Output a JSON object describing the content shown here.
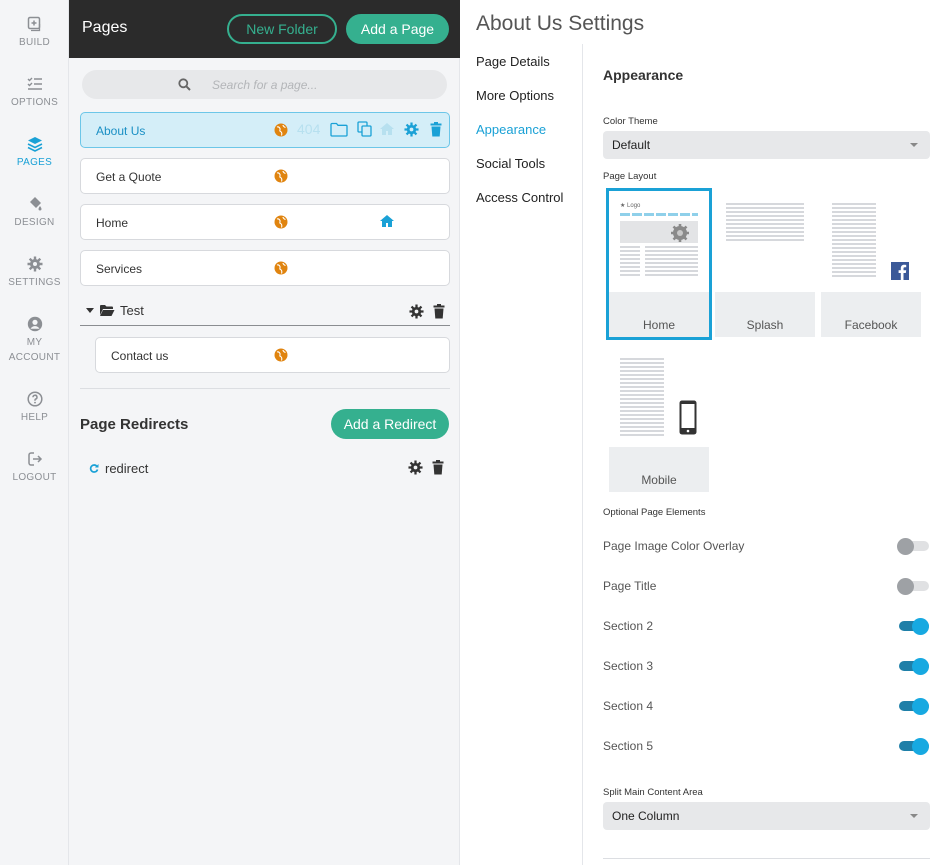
{
  "colors": {
    "accent": "#1aa1d6",
    "green": "#35b08f",
    "header_dark": "#2b2b2b",
    "globe_orange": "#e0840f"
  },
  "rail": {
    "items": [
      {
        "label": "BUILD",
        "icon": "plus-square-icon"
      },
      {
        "label": "OPTIONS",
        "icon": "checklist-icon"
      },
      {
        "label": "PAGES",
        "icon": "layers-icon",
        "active": true
      },
      {
        "label": "DESIGN",
        "icon": "paint-bucket-icon"
      },
      {
        "label": "SETTINGS",
        "icon": "gear-icon"
      },
      {
        "label": "MY ACCOUNT",
        "line1": "MY",
        "line2": "ACCOUNT",
        "icon": "user-circle-icon"
      },
      {
        "label": "HELP",
        "icon": "help-circle-icon"
      },
      {
        "label": "LOGOUT",
        "icon": "logout-icon"
      }
    ]
  },
  "pages_panel": {
    "title": "Pages",
    "new_folder_label": "New Folder",
    "add_page_label": "Add a Page",
    "search_placeholder": "Search for a page...",
    "pages": [
      {
        "name": "About Us",
        "active": true,
        "badge_404": "404"
      },
      {
        "name": "Get a Quote"
      },
      {
        "name": "Home",
        "is_home": true
      },
      {
        "name": "Services"
      }
    ],
    "folder": {
      "name": "Test",
      "pages": [
        {
          "name": "Contact us"
        }
      ]
    },
    "redirects_title": "Page Redirects",
    "add_redirect_label": "Add a Redirect",
    "redirects": [
      {
        "name": "redirect"
      }
    ]
  },
  "settings": {
    "title": "About Us Settings",
    "tabs": [
      "Page Details",
      "More Options",
      "Appearance",
      "Social Tools",
      "Access Control"
    ],
    "active_tab": "Appearance",
    "section_title": "Appearance",
    "color_theme_label": "Color Theme",
    "color_theme_value": "Default",
    "page_layout_label": "Page Layout",
    "layouts": [
      {
        "name": "Home",
        "selected": true,
        "logo_text": "★ Logo"
      },
      {
        "name": "Splash"
      },
      {
        "name": "Facebook"
      },
      {
        "name": "Mobile"
      }
    ],
    "optional_label": "Optional Page Elements",
    "toggles": [
      {
        "label": "Page Image Color Overlay",
        "on": false
      },
      {
        "label": "Page Title",
        "on": false
      },
      {
        "label": "Section 2",
        "on": true
      },
      {
        "label": "Section 3",
        "on": true
      },
      {
        "label": "Section 4",
        "on": true
      },
      {
        "label": "Section 5",
        "on": true
      }
    ],
    "split_label": "Split Main Content Area",
    "split_value": "One Column"
  }
}
